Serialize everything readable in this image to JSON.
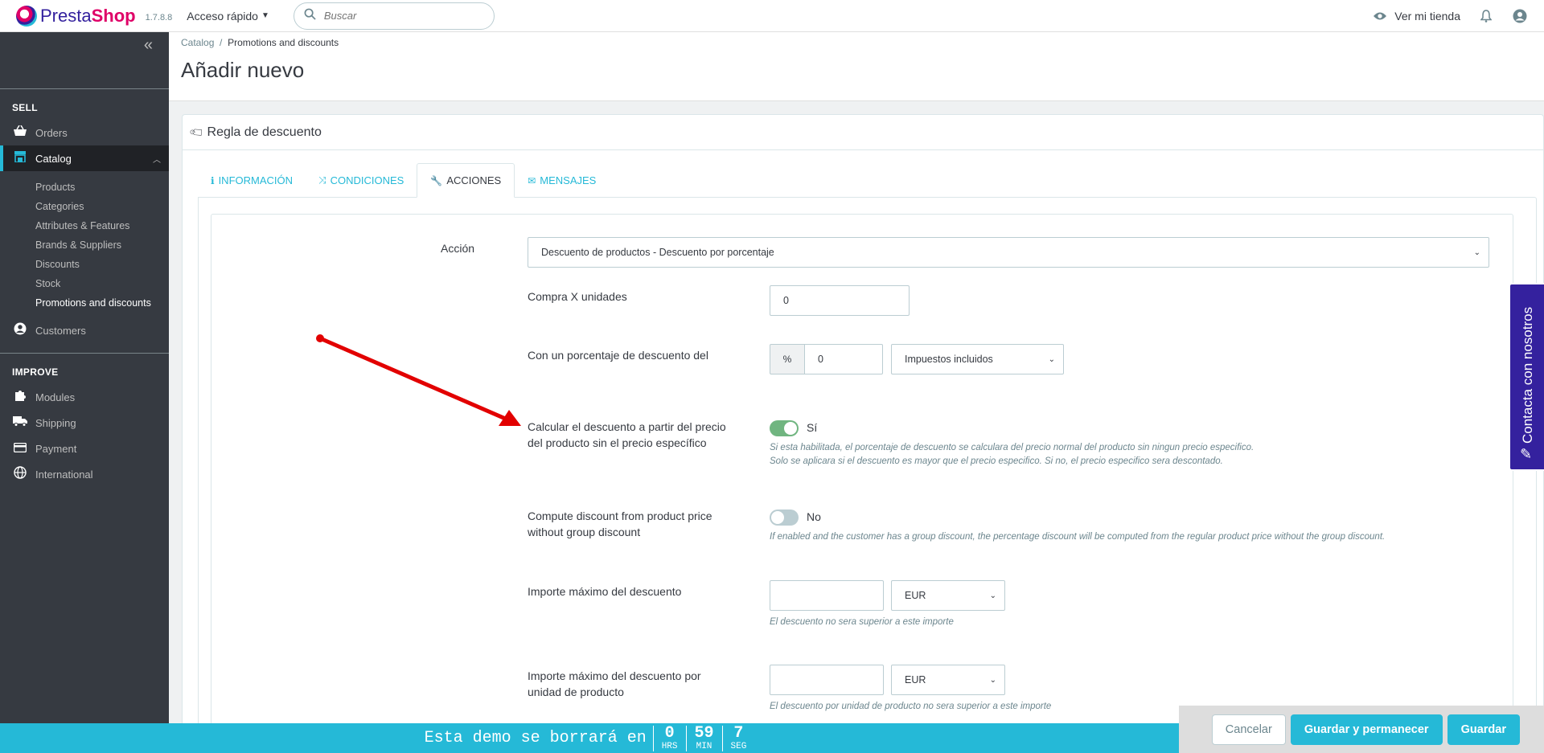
{
  "header": {
    "logo_text_1": "Presta",
    "logo_text_2": "Shop",
    "version": "1.7.8.8",
    "quick_access": "Acceso rápido",
    "search_placeholder": "Buscar",
    "view_shop": "Ver mi tienda"
  },
  "sidebar": {
    "sell_title": "SELL",
    "improve_title": "IMPROVE",
    "items": {
      "orders": "Orders",
      "catalog": "Catalog",
      "customers": "Customers",
      "modules": "Modules",
      "shipping": "Shipping",
      "payment": "Payment",
      "international": "International"
    },
    "catalog_sub": [
      "Products",
      "Categories",
      "Attributes & Features",
      "Brands & Suppliers",
      "Discounts",
      "Stock",
      "Promotions and discounts"
    ],
    "accent_color": "#25b9d7"
  },
  "page": {
    "breadcrumb_parent": "Catalog",
    "breadcrumb_sep": "/",
    "breadcrumb_current": "Promotions and discounts",
    "title": "Añadir nuevo"
  },
  "panel": {
    "title": "Regla de descuento",
    "tabs": [
      "INFORMACIÓN",
      "CONDICIONES",
      "ACCIONES",
      "MENSAJES"
    ],
    "active_tab": "ACCIONES"
  },
  "form": {
    "accion_label": "Acción",
    "accion_value": "Descuento de productos - Descuento por porcentaje",
    "compra_label": "Compra X unidades",
    "compra_value": "0",
    "porcentaje_label": "Con un porcentaje de descuento del",
    "porcentaje_prefix": "%",
    "porcentaje_value": "0",
    "impuestos_value": "Impuestos incluidos",
    "calcular_label_1": "Calcular el descuento a partir del precio",
    "calcular_label_2": "del producto sin el precio específico",
    "calcular_state": "Sí",
    "calcular_help_1": "Si esta habilitada, el porcentaje de descuento se calculara del precio normal del producto sin ningun precio especifico.",
    "calcular_help_2": "Solo se aplicara si el descuento es mayor que el precio especifico. Si no, el precio especifico sera descontado.",
    "compute_label_1": "Compute discount from product price",
    "compute_label_2": "without group discount",
    "compute_state": "No",
    "compute_help": "If enabled and the customer has a group discount, the percentage discount will be computed from the regular product price without the group discount.",
    "importe_label": "Importe máximo del descuento",
    "importe_value": "",
    "importe_currency": "EUR",
    "importe_help": "El descuento no sera superior a este importe",
    "importe_unidad_label_1": "Importe máximo del descuento por",
    "importe_unidad_label_2": "unidad de producto",
    "importe_unidad_value": "",
    "importe_unidad_currency": "EUR",
    "importe_unidad_help": "El descuento por unidad de producto no sera superior a este importe"
  },
  "contact_tab": "Contacta con nosotros",
  "demo": {
    "text": "Esta demo se borrará en",
    "hours": "0",
    "hours_unit": "HRS",
    "minutes": "59",
    "minutes_unit": "MIN",
    "seconds": "7",
    "seconds_unit": "SEG"
  },
  "footer": {
    "cancel": "Cancelar",
    "save_stay": "Guardar y permanecer",
    "save": "Guardar"
  }
}
